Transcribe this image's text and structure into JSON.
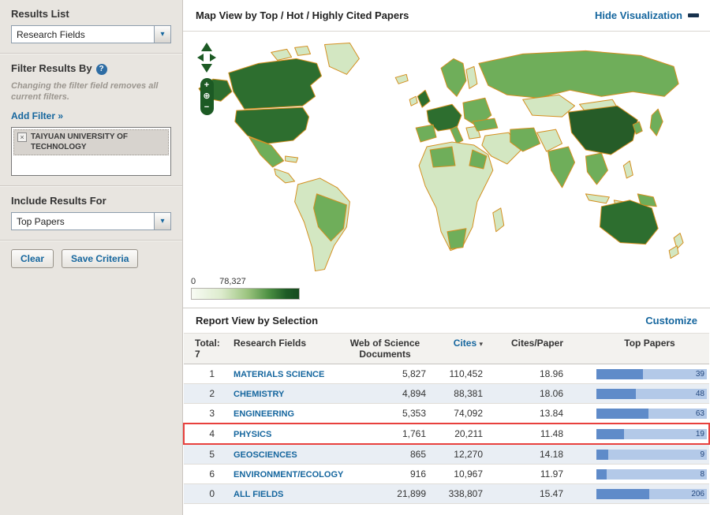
{
  "colors": {
    "text-dark": "#333333",
    "link-blue": "#15669e",
    "sidebar-bg": "#e8e5e0",
    "highlight-red": "#e8403d",
    "bar-fill": "#5f8bc9",
    "bar-track": "#b3c9e8",
    "row-alt": "#e9eef4",
    "map-dark": "#2d6e2f",
    "map-medium": "#6fae5a",
    "map-light": "#d3e7c2",
    "map-vlight": "#edf5e4",
    "map-border": "#d48f1f",
    "control-green": "#1c5a24"
  },
  "icons": {
    "select-arrow": "▾",
    "sort-desc": "▾",
    "remove": "×",
    "help": "?",
    "zoom-in": "+",
    "zoom-out": "−",
    "globe": "⊕"
  },
  "sidebar": {
    "results_list": {
      "title": "Results List",
      "dropdown_value": "Research Fields"
    },
    "filter": {
      "title": "Filter Results By",
      "note": "Changing the filter field removes all current filters.",
      "add_filter": "Add Filter »",
      "selected_filter": "TAIYUAN UNIVERSITY OF TECHNOLOGY"
    },
    "include": {
      "title": "Include Results For",
      "dropdown_value": "Top Papers"
    },
    "actions": {
      "clear": "Clear",
      "save": "Save Criteria"
    }
  },
  "map": {
    "title": "Map View by Top / Hot / Highly Cited Papers",
    "hide_link": "Hide Visualization",
    "legend_min": "0",
    "legend_max": "78,327"
  },
  "report": {
    "title": "Report View by Selection",
    "customize": "Customize",
    "columns": {
      "rank": "Total:\n7",
      "field": "Research Fields",
      "docs": "Web of Science\nDocuments",
      "cites": "Cites",
      "cpp": "Cites/Paper",
      "top": "Top Papers"
    },
    "rows": [
      {
        "rank": "1",
        "field": "MATERIALS SCIENCE",
        "docs": "5,827",
        "cites": "110,452",
        "cpp": "18.96",
        "top": "39",
        "fill_pct": 42,
        "alt": false,
        "highlight": false
      },
      {
        "rank": "2",
        "field": "CHEMISTRY",
        "docs": "4,894",
        "cites": "88,381",
        "cpp": "18.06",
        "top": "48",
        "fill_pct": 36,
        "alt": true,
        "highlight": false
      },
      {
        "rank": "3",
        "field": "ENGINEERING",
        "docs": "5,353",
        "cites": "74,092",
        "cpp": "13.84",
        "top": "63",
        "fill_pct": 47,
        "alt": false,
        "highlight": false
      },
      {
        "rank": "4",
        "field": "PHYSICS",
        "docs": "1,761",
        "cites": "20,211",
        "cpp": "11.48",
        "top": "19",
        "fill_pct": 25,
        "alt": false,
        "highlight": true
      },
      {
        "rank": "5",
        "field": "GEOSCIENCES",
        "docs": "865",
        "cites": "12,270",
        "cpp": "14.18",
        "top": "9",
        "fill_pct": 11,
        "alt": true,
        "highlight": false
      },
      {
        "rank": "6",
        "field": "ENVIRONMENT/ECOLOGY",
        "docs": "916",
        "cites": "10,967",
        "cpp": "11.97",
        "top": "8",
        "fill_pct": 9,
        "alt": false,
        "highlight": false
      },
      {
        "rank": "0",
        "field": "ALL FIELDS",
        "docs": "21,899",
        "cites": "338,807",
        "cpp": "15.47",
        "top": "206",
        "fill_pct": 48,
        "alt": true,
        "highlight": false
      }
    ]
  }
}
